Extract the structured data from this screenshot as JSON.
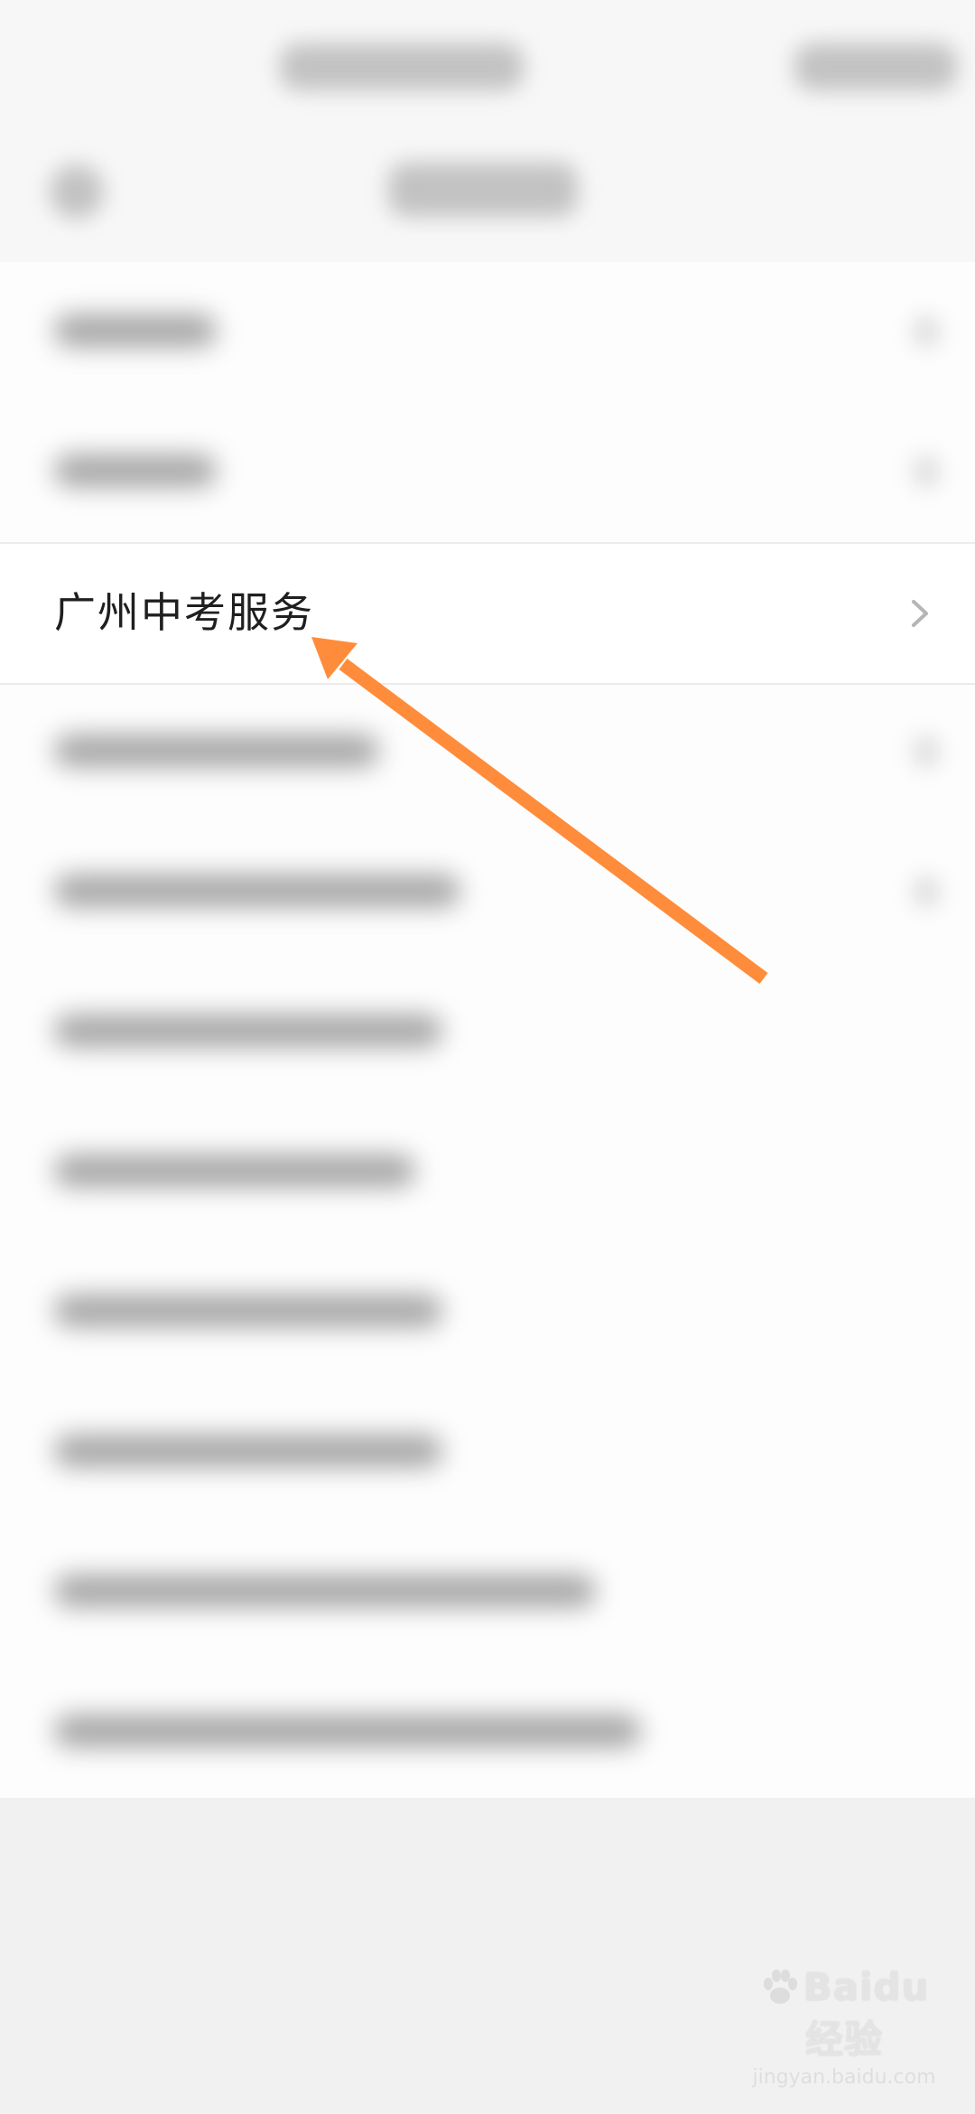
{
  "list": {
    "highlighted_item": {
      "label": "广州中考服务"
    }
  },
  "overlay": {
    "arrow_color": "#ff8c3a"
  },
  "watermark": {
    "brand": "Baidu经验",
    "url": "jingyan.baidu.com"
  }
}
